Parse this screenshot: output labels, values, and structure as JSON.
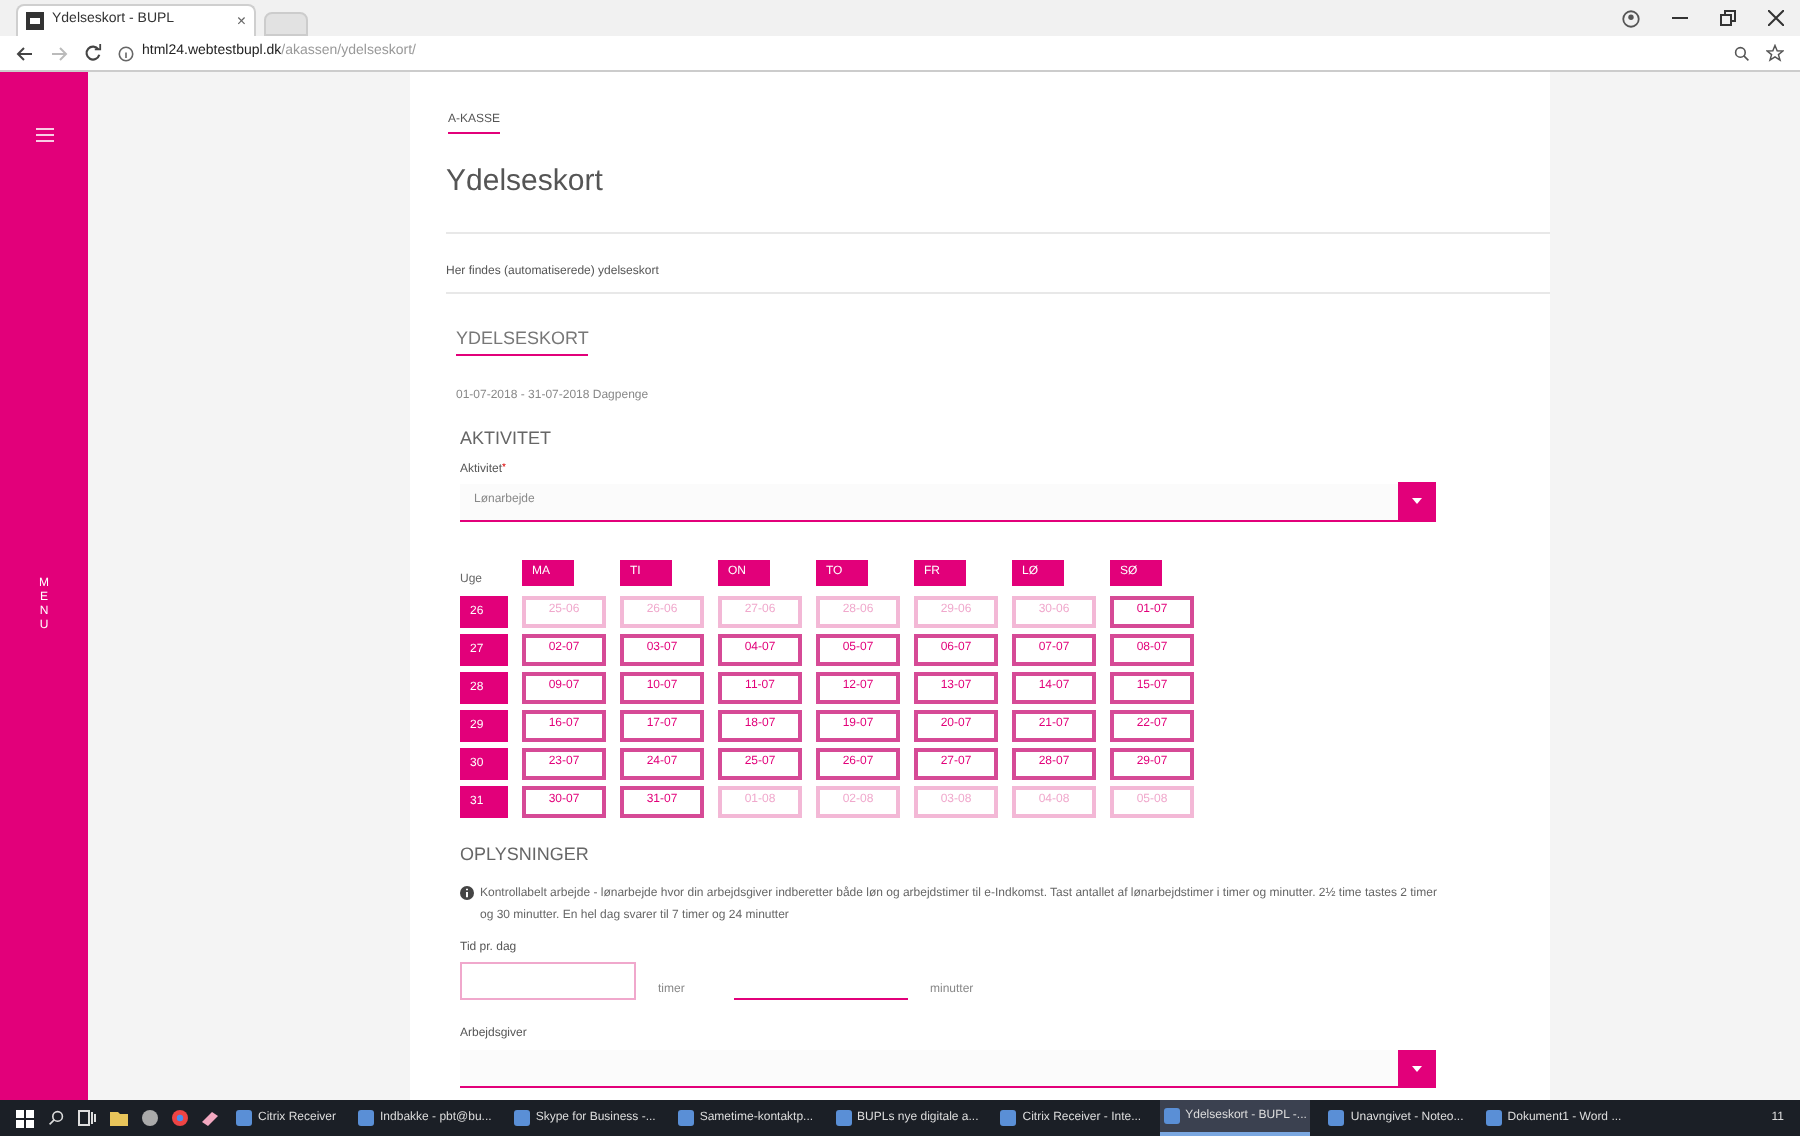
{
  "browser": {
    "tab_title": "Ydelseskort - BUPL",
    "tab_close": "×",
    "url_host": "html24.webtestbupl.dk",
    "url_path": "/akassen/ydelseskort/"
  },
  "sidebar": {
    "label": "MENU"
  },
  "breadcrumb": "A-KASSE",
  "title": "Ydelseskort",
  "intro": "Her findes (automatiserede) ydelseskort",
  "section_title": "YDELSESKORT",
  "period": "01-07-2018 - 31-07-2018 Dagpenge",
  "activity": {
    "heading": "AKTIVITET",
    "label": "Aktivitet",
    "required_mark": "*",
    "value": "Lønarbejde"
  },
  "calendar": {
    "week_label": "Uge",
    "days": [
      "MA",
      "TI",
      "ON",
      "TO",
      "FR",
      "LØ",
      "SØ"
    ],
    "weeks": [
      {
        "week": "26",
        "cells": [
          {
            "date": "25-06",
            "in_period": false
          },
          {
            "date": "26-06",
            "in_period": false
          },
          {
            "date": "27-06",
            "in_period": false
          },
          {
            "date": "28-06",
            "in_period": false
          },
          {
            "date": "29-06",
            "in_period": false
          },
          {
            "date": "30-06",
            "in_period": false
          },
          {
            "date": "01-07",
            "in_period": true
          }
        ]
      },
      {
        "week": "27",
        "cells": [
          {
            "date": "02-07",
            "in_period": true
          },
          {
            "date": "03-07",
            "in_period": true
          },
          {
            "date": "04-07",
            "in_period": true
          },
          {
            "date": "05-07",
            "in_period": true
          },
          {
            "date": "06-07",
            "in_period": true
          },
          {
            "date": "07-07",
            "in_period": true
          },
          {
            "date": "08-07",
            "in_period": true
          }
        ]
      },
      {
        "week": "28",
        "cells": [
          {
            "date": "09-07",
            "in_period": true
          },
          {
            "date": "10-07",
            "in_period": true
          },
          {
            "date": "11-07",
            "in_period": true
          },
          {
            "date": "12-07",
            "in_period": true
          },
          {
            "date": "13-07",
            "in_period": true
          },
          {
            "date": "14-07",
            "in_period": true
          },
          {
            "date": "15-07",
            "in_period": true
          }
        ]
      },
      {
        "week": "29",
        "cells": [
          {
            "date": "16-07",
            "in_period": true
          },
          {
            "date": "17-07",
            "in_period": true
          },
          {
            "date": "18-07",
            "in_period": true
          },
          {
            "date": "19-07",
            "in_period": true
          },
          {
            "date": "20-07",
            "in_period": true
          },
          {
            "date": "21-07",
            "in_period": true
          },
          {
            "date": "22-07",
            "in_period": true
          }
        ]
      },
      {
        "week": "30",
        "cells": [
          {
            "date": "23-07",
            "in_period": true
          },
          {
            "date": "24-07",
            "in_period": true
          },
          {
            "date": "25-07",
            "in_period": true
          },
          {
            "date": "26-07",
            "in_period": true
          },
          {
            "date": "27-07",
            "in_period": true
          },
          {
            "date": "28-07",
            "in_period": true
          },
          {
            "date": "29-07",
            "in_period": true
          }
        ]
      },
      {
        "week": "31",
        "cells": [
          {
            "date": "30-07",
            "in_period": true
          },
          {
            "date": "31-07",
            "in_period": true
          },
          {
            "date": "01-08",
            "in_period": false
          },
          {
            "date": "02-08",
            "in_period": false
          },
          {
            "date": "03-08",
            "in_period": false
          },
          {
            "date": "04-08",
            "in_period": false
          },
          {
            "date": "05-08",
            "in_period": false
          }
        ]
      }
    ]
  },
  "info": {
    "heading": "OPLYSNINGER",
    "text": "Kontrollabelt arbejde - lønarbejde hvor din arbejdsgiver indberetter både løn og arbejdstimer til e-Indkomst. Tast antallet af lønarbejdstimer i timer og minutter. 2½ time tastes 2 timer og 30 minutter. En hel dag svarer til 7 timer og 24 minutter"
  },
  "time": {
    "label": "Tid pr. dag",
    "hours_unit": "timer",
    "minutes_unit": "minutter"
  },
  "employer": {
    "label": "Arbejdsgiver"
  },
  "taskbar": {
    "items": [
      {
        "label": "Citrix Receiver",
        "active": false
      },
      {
        "label": "Indbakke - pbt@bu...",
        "active": false
      },
      {
        "label": "Skype for Business -...",
        "active": false
      },
      {
        "label": "Sametime-kontaktp...",
        "active": false
      },
      {
        "label": "BUPLs nye digitale a...",
        "active": false
      },
      {
        "label": "Citrix Receiver - Inte...",
        "active": false
      },
      {
        "label": "Ydelseskort - BUPL -...",
        "active": true
      },
      {
        "label": "Unavngivet - Noteo...",
        "active": false
      },
      {
        "label": "Dokument1 - Word ...",
        "active": false
      }
    ],
    "clock": "11"
  }
}
